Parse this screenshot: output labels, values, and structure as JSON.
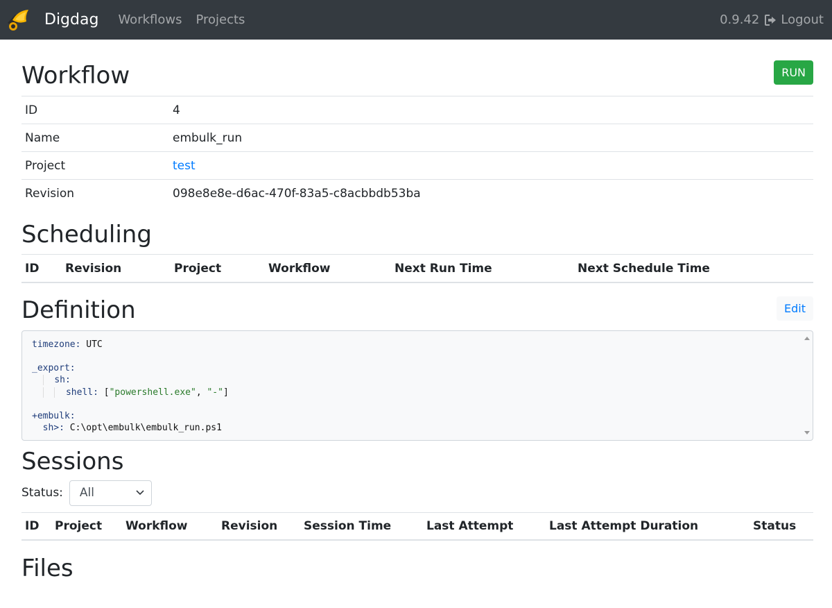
{
  "nav": {
    "brand": "Digdag",
    "links": [
      "Workflows",
      "Projects"
    ],
    "version": "0.9.42",
    "logout": "Logout"
  },
  "workflow": {
    "heading": "Workflow",
    "run_label": "RUN",
    "rows": [
      {
        "key": "ID",
        "value": "4"
      },
      {
        "key": "Name",
        "value": "embulk_run"
      },
      {
        "key": "Project",
        "value": "test"
      },
      {
        "key": "Revision",
        "value": "098e8e8e-d6ac-470f-83a5-c8acbbdb53ba"
      }
    ]
  },
  "scheduling": {
    "heading": "Scheduling",
    "columns": [
      "ID",
      "Revision",
      "Project",
      "Workflow",
      "Next Run Time",
      "Next Schedule Time"
    ]
  },
  "definition": {
    "heading": "Definition",
    "edit_label": "Edit",
    "code": {
      "timezone_key": "timezone:",
      "timezone_val": "UTC",
      "export_key": "_export:",
      "sh_key": "sh:",
      "shell_key": "shell:",
      "shell_open": "[",
      "shell_arg1": "\"powershell.exe\"",
      "shell_sep": ", ",
      "shell_arg2": "\"-\"",
      "shell_close": "]",
      "task_key": "+embulk:",
      "shcmd_key": "sh>:",
      "shcmd_val": "C:\\opt\\embulk\\embulk_run.ps1"
    }
  },
  "sessions": {
    "heading": "Sessions",
    "status_label": "Status:",
    "status_value": "All",
    "columns": [
      "ID",
      "Project",
      "Workflow",
      "Revision",
      "Session Time",
      "Last Attempt",
      "Last Attempt Duration",
      "Status"
    ]
  },
  "files": {
    "heading": "Files"
  },
  "colors": {
    "navbar": "#343a40",
    "run_button": "#28a745",
    "link": "#007bff"
  }
}
